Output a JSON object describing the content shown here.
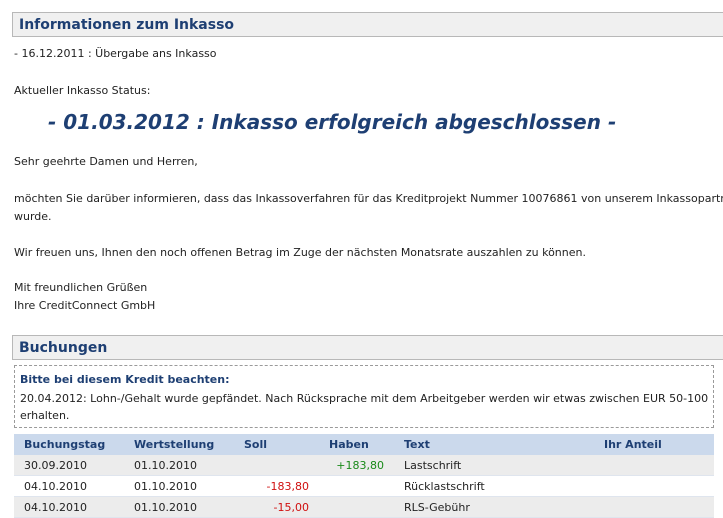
{
  "info": {
    "title": "Informationen zum Inkasso",
    "event_line": "- 16.12.2011 : Übergabe ans Inkasso",
    "status_label": "Aktueller Inkasso Status:",
    "status_value": "- 01.03.2012 : Inkasso erfolgreich abgeschlossen -",
    "greeting": "Sehr geehrte Damen und Herren,",
    "para1_line1": "möchten Sie darüber informieren, dass das Inkassoverfahren für das Kreditprojekt Nummer 10076861 von unserem Inkassopartner",
    "para1_line2": "wurde.",
    "para2": "Wir freuen uns, Ihnen den noch offenen Betrag im Zuge der nächsten Monatsrate auszahlen zu können.",
    "closing": "Mit freundlichen Grüßen",
    "signature": "Ihre CreditConnect GmbH"
  },
  "bookings": {
    "title": "Buchungen",
    "notice_title": "Bitte bei diesem Kredit beachten:",
    "notice_body": "20.04.2012: Lohn-/Gehalt wurde gepfändet. Nach Rücksprache mit dem Arbeitgeber werden wir etwas zwischen EUR 50-100 erhalten.",
    "columns": {
      "date": "Buchungstag",
      "value_date": "Wertstellung",
      "debit": "Soll",
      "credit": "Haben",
      "text": "Text",
      "share": "Ihr Anteil"
    },
    "rows": [
      {
        "date": "30.09.2010",
        "value_date": "01.10.2010",
        "debit": "",
        "credit": "+183,80",
        "text": "Lastschrift",
        "share": ""
      },
      {
        "date": "04.10.2010",
        "value_date": "01.10.2010",
        "debit": "-183,80",
        "credit": "",
        "text": "Rücklastschrift",
        "share": ""
      },
      {
        "date": "04.10.2010",
        "value_date": "01.10.2010",
        "debit": "-15,00",
        "credit": "",
        "text": "RLS-Gebühr",
        "share": ""
      }
    ]
  },
  "colors": {
    "heading": "#1e3f73",
    "positive": "#1a8a1a",
    "negative": "#d01010",
    "table_header_bg": "#cbd9ec"
  }
}
